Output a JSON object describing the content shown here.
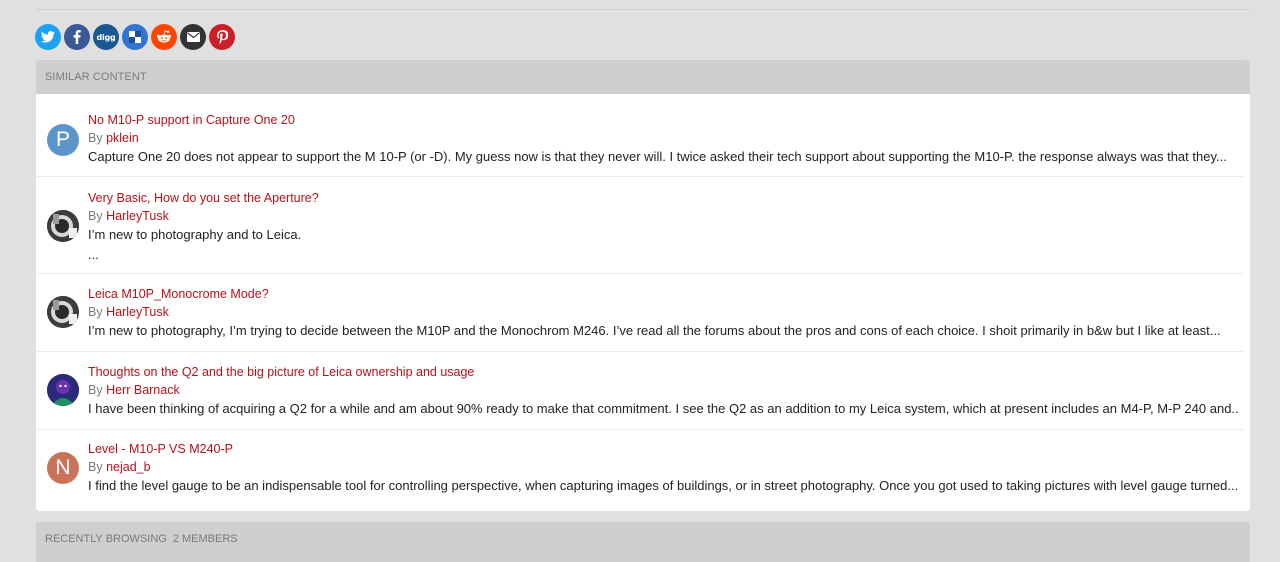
{
  "share": [
    {
      "name": "twitter",
      "color": "#1da1f2"
    },
    {
      "name": "facebook",
      "color": "#3b5998"
    },
    {
      "name": "digg",
      "color": "#1b5891",
      "label": "digg"
    },
    {
      "name": "delicious",
      "color": "#3274d1"
    },
    {
      "name": "reddit",
      "color": "#ff4500"
    },
    {
      "name": "email",
      "color": "#333333"
    },
    {
      "name": "pinterest",
      "color": "#cb2027"
    }
  ],
  "similar": {
    "header": "Similar Content",
    "by_label": "By",
    "items": [
      {
        "title": "No M10-P support in Capture One 20",
        "author": "pklein",
        "avatar_letter": "P",
        "avatar_color": "#5b95c9",
        "excerpt": "Capture One 20  does not appear to support the M 10-P (or -D).  My guess now is that they never will. I twice asked their tech support about supporting the M10-P. the response always was that they..."
      },
      {
        "title": "Very Basic, How do you set the Aperture?",
        "author": "HarleyTusk",
        "avatar_letter": "",
        "avatar_color": "#555555",
        "excerpt": "I’m new to photography and to Leica.",
        "excerpt2": "..."
      },
      {
        "title": "Leica M10P_Monocrome Mode?",
        "author": "HarleyTusk",
        "avatar_letter": "",
        "avatar_color": "#555555",
        "excerpt": "I’m new to photography, I’m trying to decide between the M10P and the Monochrom M246. I’ve read all the forums about the pros and cons of each choice. I shoit primarily in b&w but I like at least..."
      },
      {
        "title": "Thoughts on the Q2 and the big picture of Leica ownership and usage",
        "author": "Herr Barnack",
        "avatar_letter": "",
        "avatar_color": "#3a2f8a",
        "excerpt": "I have been thinking of acquiring a Q2 for a while and am about 90% ready to make that commitment.  I see the Q2 as an addition to my Leica system, which at present includes an M4-P, M-P 240 and..."
      },
      {
        "title": "Level - M10-P VS M240-P",
        "author": "nejad_b",
        "avatar_letter": "N",
        "avatar_color": "#c9745a",
        "excerpt": "I find the level gauge to be an indispensable tool for controlling perspective, when capturing images of buildings, or in street photography. Once you got used to taking pictures with level gauge turned..."
      }
    ]
  },
  "recently": {
    "header": "Recently Browsing",
    "count": "2 members"
  }
}
